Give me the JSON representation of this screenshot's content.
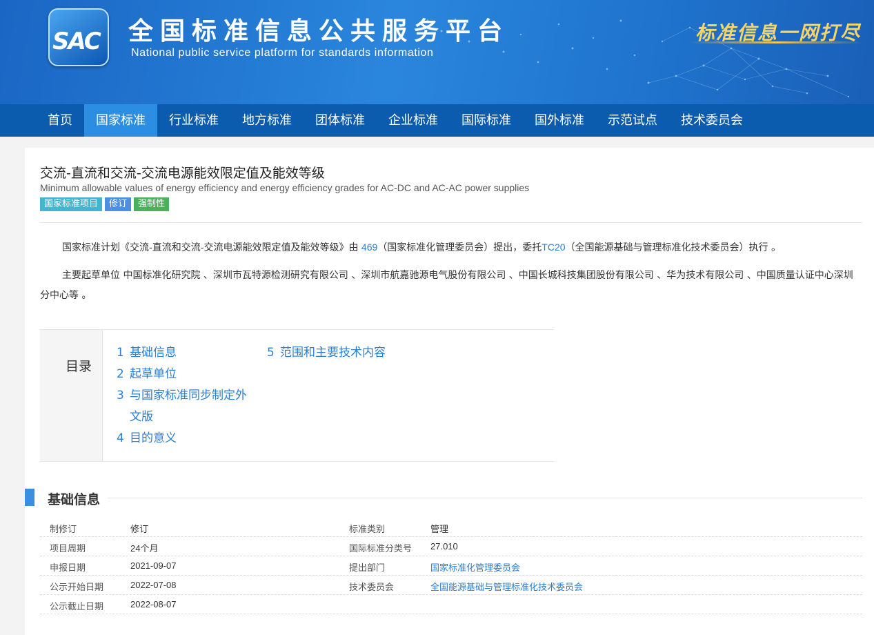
{
  "header": {
    "logo_text": "SAC",
    "title": "全国标准信息公共服务平台",
    "subtitle": "National public service platform  for standards information",
    "slogan": "标准信息一网打尽"
  },
  "nav": {
    "items": [
      {
        "label": "首页"
      },
      {
        "label": "国家标准"
      },
      {
        "label": "行业标准"
      },
      {
        "label": "地方标准"
      },
      {
        "label": "团体标准"
      },
      {
        "label": "企业标准"
      },
      {
        "label": "国际标准"
      },
      {
        "label": "国外标准"
      },
      {
        "label": "示范试点"
      },
      {
        "label": "技术委员会"
      }
    ],
    "active": "国家标准"
  },
  "standard": {
    "title": "交流-直流和交流-交流电源能效限定值及能效等级",
    "title_en": "Minimum allowable values of energy efficiency and energy efficiency grades for AC-DC and AC-AC power supplies",
    "tags": [
      "国家标准项目",
      "修订",
      "强制性"
    ]
  },
  "plan": {
    "text_prefix": "国家标准计划《交流-直流和交流-交流电源能效限定值及能效等级》由 ",
    "proposer_code": "469",
    "text_mid": "（国家标准化管理委员会）提出，委托",
    "tc_code": "TC20",
    "text_suffix": "（全国能源基础与管理标准化技术委员会）执行 。"
  },
  "drafters": {
    "text": "主要起草单位 中国标准化研究院 、深圳市瓦特源检测研究有限公司 、深圳市航嘉驰源电气股份有限公司 、中国长城科技集团股份有限公司 、华为技术有限公司 、中国质量认证中心深圳分中心等 。"
  },
  "toc": {
    "label": "目录",
    "items": [
      {
        "num": "1",
        "text": "基础信息"
      },
      {
        "num": "2",
        "text": "起草单位"
      },
      {
        "num": "3",
        "text": "与国家标准同步制定外文版"
      },
      {
        "num": "4",
        "text": "目的意义"
      },
      {
        "num": "5",
        "text": "范围和主要技术内容"
      }
    ]
  },
  "basic_info": {
    "section_title": "基础信息",
    "rows": [
      {
        "l1": "制修订",
        "v1": "修订",
        "l2": "标准类别",
        "v2": "管理"
      },
      {
        "l1": "项目周期",
        "v1": "24个月",
        "l2": "国际标准分类号",
        "v2": "27.010"
      },
      {
        "l1": "申报日期",
        "v1": "2021-09-07",
        "l2": "提出部门",
        "v2": "国家标准化管理委员会"
      },
      {
        "l1": "公示开始日期",
        "v1": "2022-07-08",
        "l2": "技术委员会",
        "v2": "全国能源基础与管理标准化技术委员会"
      },
      {
        "l1": "公示截止日期",
        "v1": "2022-08-07",
        "l2": "",
        "v2": ""
      }
    ]
  }
}
